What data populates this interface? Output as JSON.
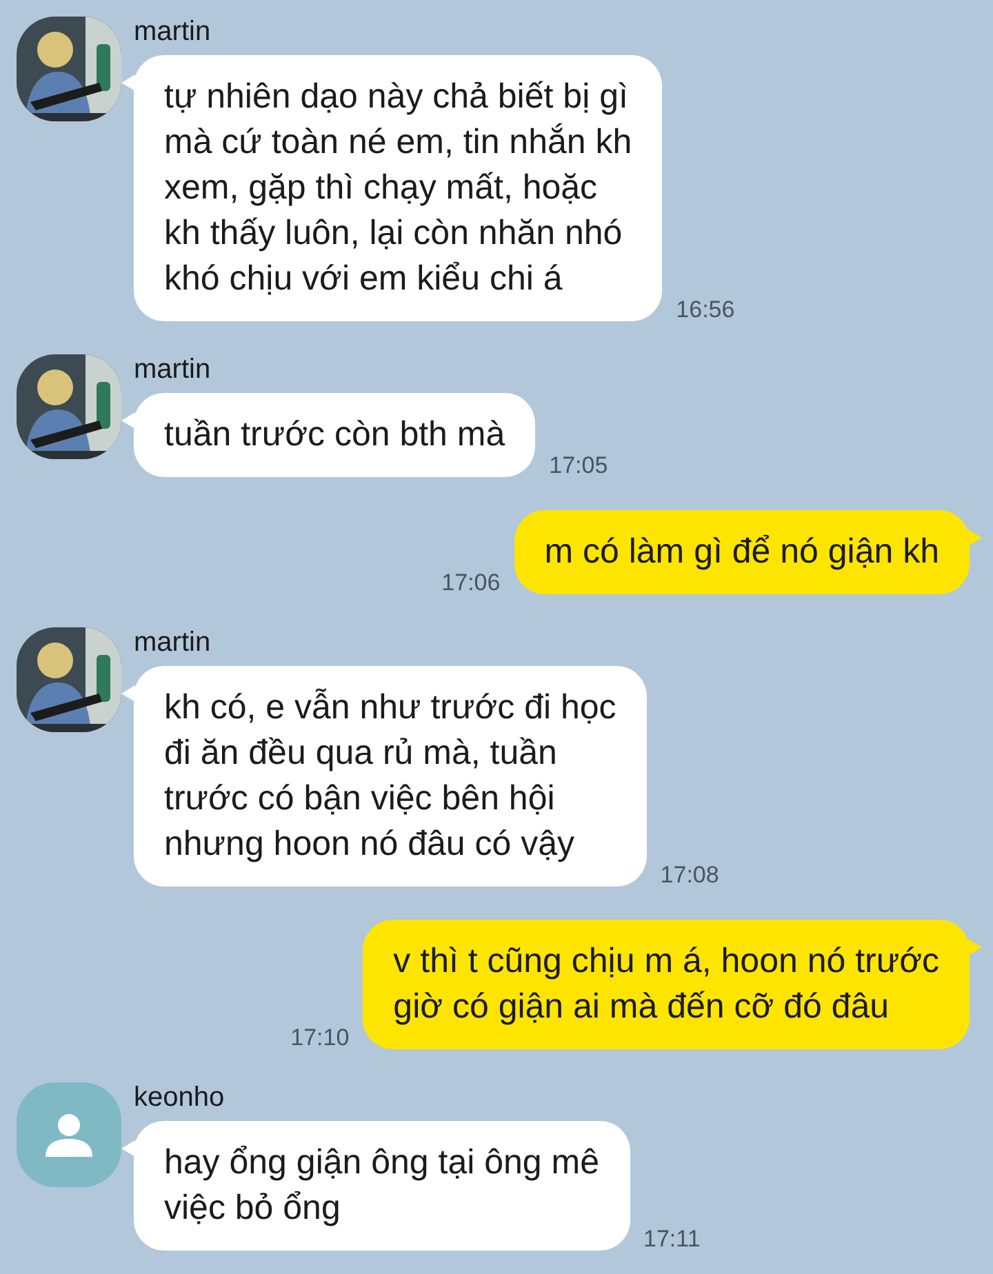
{
  "messages": [
    {
      "kind": "received",
      "sender": "martin",
      "text": "tự nhiên dạo này chả biết bị gì\nmà cứ toàn né em, tin nhắn kh\nxem, gặp thì chạy mất, hoặc\nkh thấy luôn, lại còn nhăn nhó\nkhó chịu với em kiểu chi á",
      "time": "16:56"
    },
    {
      "kind": "received",
      "sender": "martin",
      "text": "tuần trước còn bth mà",
      "time": "17:05"
    },
    {
      "kind": "sent",
      "text": "m có làm gì để nó giận kh",
      "time": "17:06"
    },
    {
      "kind": "received",
      "sender": "martin",
      "text": "kh có, e vẫn như trước đi học\nđi ăn đều qua rủ mà, tuần\ntrước có bận việc bên hội\nnhưng hoon nó đâu có vậy",
      "time": "17:08"
    },
    {
      "kind": "sent",
      "text": "v thì t cũng chịu m á, hoon nó trước\ngiờ có giận ai mà đến cỡ đó đâu",
      "time": "17:10"
    },
    {
      "kind": "received",
      "sender": "keonho",
      "avatar": {
        "kind": "default"
      },
      "text": "hay ổng giận ông tại ông mê\nviệc bỏ ổng",
      "time": "17:11"
    }
  ]
}
